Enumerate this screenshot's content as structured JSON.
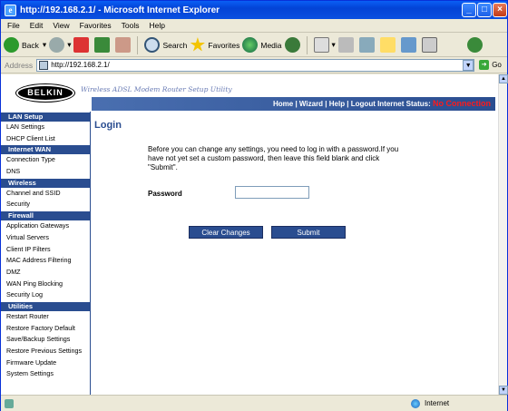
{
  "window": {
    "title": "http://192.168.2.1/ - Microsoft Internet Explorer"
  },
  "menu": [
    "File",
    "Edit",
    "View",
    "Favorites",
    "Tools",
    "Help"
  ],
  "toolbar": {
    "back": "Back",
    "search": "Search",
    "favorites": "Favorites",
    "media": "Media"
  },
  "address": {
    "label": "Address",
    "url": "http://192.168.2.1/",
    "go": "Go"
  },
  "header": {
    "brand": "BELKIN",
    "tagline": "Wireless ADSL Modem Router Setup Utility",
    "nav": "Home | Wizard | Help | Logout    Internet Status:",
    "status": "No Connection"
  },
  "sidebar": [
    {
      "section": "LAN Setup",
      "items": [
        "LAN Settings",
        "DHCP Client List"
      ]
    },
    {
      "section": "Internet WAN",
      "items": [
        "Connection Type",
        "DNS"
      ]
    },
    {
      "section": "Wireless",
      "items": [
        "Channel and SSID",
        "Security"
      ]
    },
    {
      "section": "Firewall",
      "items": [
        "Application Gateways",
        "Virtual Servers",
        "Client IP Filters",
        "MAC Address Filtering",
        "DMZ",
        "WAN Ping Blocking",
        "Security Log"
      ]
    },
    {
      "section": "Utilities",
      "items": [
        "Restart Router",
        "Restore Factory Default",
        "Save/Backup Settings",
        "Restore Previous Settings",
        "Firmware Update",
        "System Settings"
      ]
    }
  ],
  "main": {
    "title": "Login",
    "message": "Before you can change any settings, you need to log in with a password.If you have not yet set a custom password, then leave this field blank and click \"Submit\".",
    "password_label": "Password",
    "clear_button": "Clear Changes",
    "submit_button": "Submit"
  },
  "status": {
    "zone": "Internet"
  }
}
